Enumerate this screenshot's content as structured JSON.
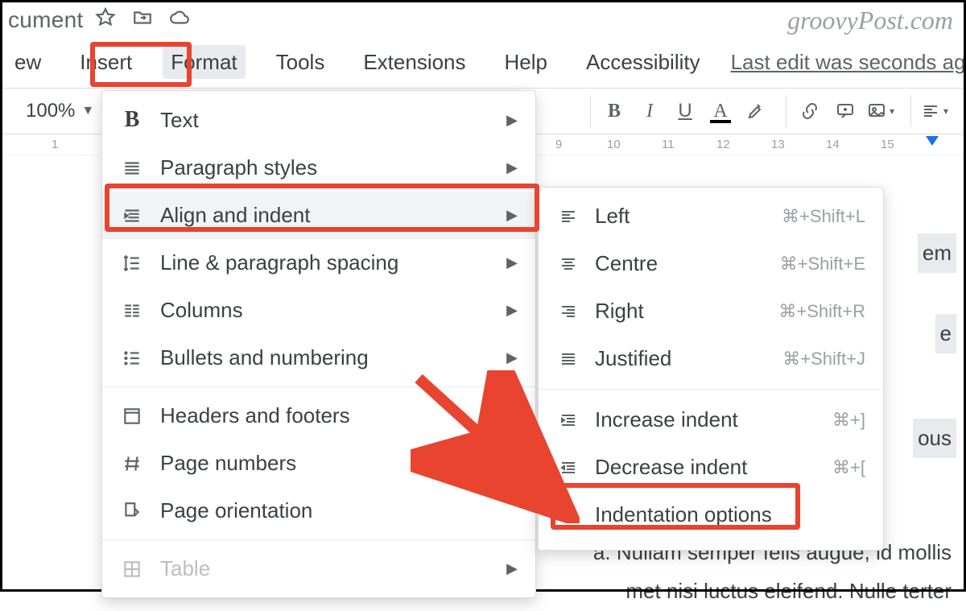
{
  "title": "cument",
  "watermark": "groovyPost.com",
  "menubar": {
    "view": "ew",
    "insert": "Insert",
    "format": "Format",
    "tools": "Tools",
    "extensions": "Extensions",
    "help": "Help",
    "accessibility": "Accessibility",
    "last_edit": "Last edit was seconds ago"
  },
  "toolbar": {
    "zoom": "100%"
  },
  "ruler": {
    "left_numbers": [
      "1"
    ],
    "right_numbers": [
      "9",
      "10",
      "11",
      "12",
      "13",
      "14",
      "15"
    ]
  },
  "format_menu": {
    "text": "Text",
    "paragraph_styles": "Paragraph styles",
    "align_indent": "Align and indent",
    "line_spacing": "Line & paragraph spacing",
    "columns": "Columns",
    "bullets": "Bullets and numbering",
    "headers_footers": "Headers and footers",
    "page_numbers": "Page numbers",
    "page_orientation": "Page orientation",
    "table": "Table"
  },
  "align_submenu": {
    "left": {
      "label": "Left",
      "shortcut": "⌘+Shift+L"
    },
    "centre": {
      "label": "Centre",
      "shortcut": "⌘+Shift+E"
    },
    "right": {
      "label": "Right",
      "shortcut": "⌘+Shift+R"
    },
    "just": {
      "label": "Justified",
      "shortcut": "⌘+Shift+J"
    },
    "inc": {
      "label": "Increase indent",
      "shortcut": "⌘+]"
    },
    "dec": {
      "label": "Decrease indent",
      "shortcut": "⌘+["
    },
    "opts": {
      "label": "Indentation options"
    }
  },
  "doc_text": {
    "s1": "em",
    "s2": "e",
    "s3": "ous",
    "s4": "a. Nullam semper felis augue, id mollis",
    "s5": "met nisi luctus eleifend. Nulle terter"
  }
}
